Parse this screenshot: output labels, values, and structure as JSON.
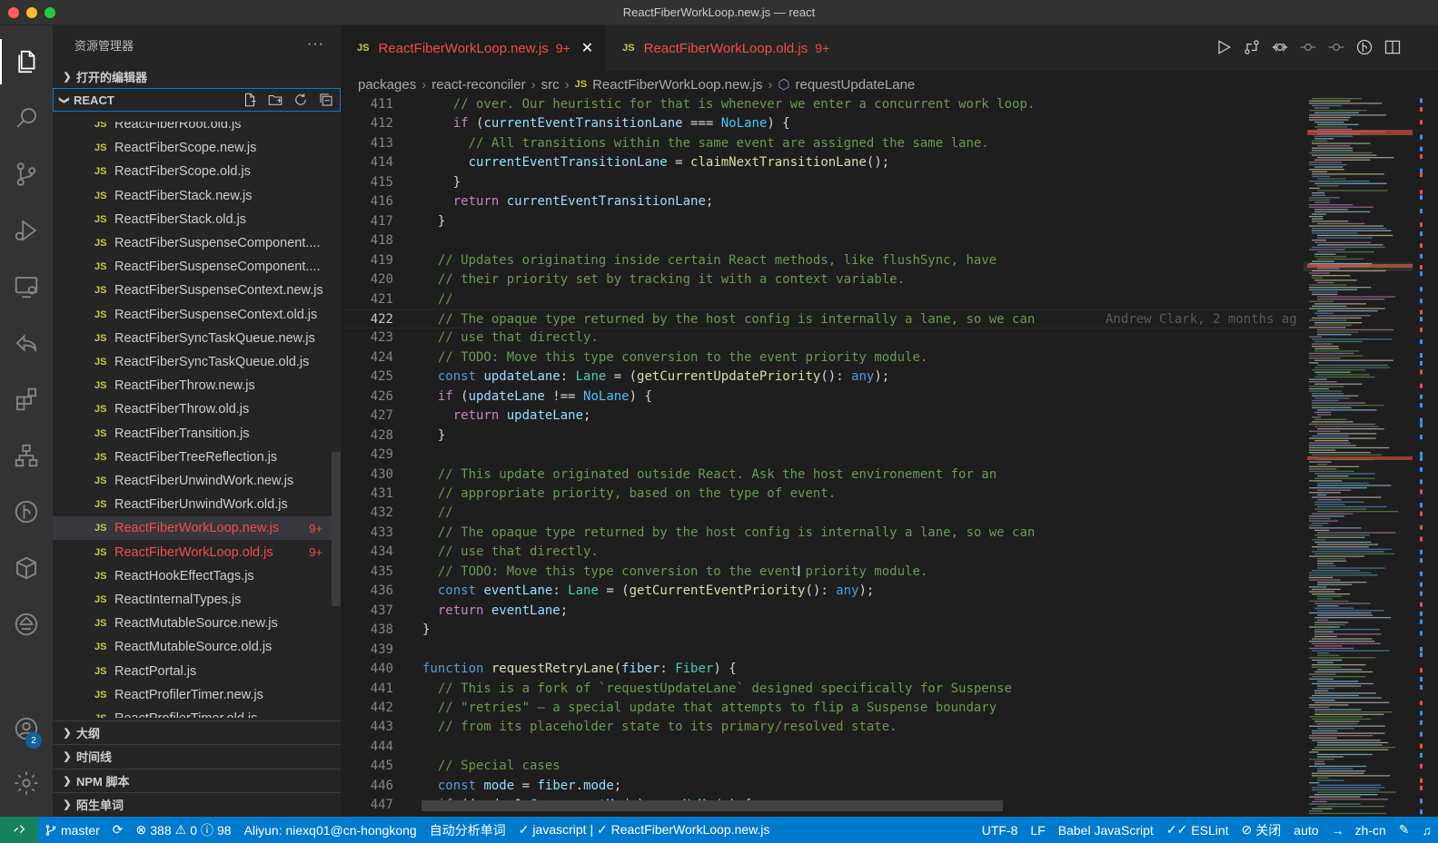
{
  "window": {
    "title": "ReactFiberWorkLoop.new.js — react"
  },
  "activity": {
    "accounts_badge": "2"
  },
  "sidebar": {
    "title": "资源管理器",
    "more": "···",
    "open_editors": "打开的编辑器",
    "root": "REACT",
    "files": [
      {
        "name": "ReactFiberRoot.old.js",
        "count": ""
      },
      {
        "name": "ReactFiberScope.new.js",
        "count": ""
      },
      {
        "name": "ReactFiberScope.old.js",
        "count": ""
      },
      {
        "name": "ReactFiberStack.new.js",
        "count": ""
      },
      {
        "name": "ReactFiberStack.old.js",
        "count": ""
      },
      {
        "name": "ReactFiberSuspenseComponent....",
        "count": ""
      },
      {
        "name": "ReactFiberSuspenseComponent....",
        "count": ""
      },
      {
        "name": "ReactFiberSuspenseContext.new.js",
        "count": ""
      },
      {
        "name": "ReactFiberSuspenseContext.old.js",
        "count": ""
      },
      {
        "name": "ReactFiberSyncTaskQueue.new.js",
        "count": ""
      },
      {
        "name": "ReactFiberSyncTaskQueue.old.js",
        "count": ""
      },
      {
        "name": "ReactFiberThrow.new.js",
        "count": ""
      },
      {
        "name": "ReactFiberThrow.old.js",
        "count": ""
      },
      {
        "name": "ReactFiberTransition.js",
        "count": ""
      },
      {
        "name": "ReactFiberTreeReflection.js",
        "count": ""
      },
      {
        "name": "ReactFiberUnwindWork.new.js",
        "count": ""
      },
      {
        "name": "ReactFiberUnwindWork.old.js",
        "count": ""
      },
      {
        "name": "ReactFiberWorkLoop.new.js",
        "count": "9+"
      },
      {
        "name": "ReactFiberWorkLoop.old.js",
        "count": "9+"
      },
      {
        "name": "ReactHookEffectTags.js",
        "count": ""
      },
      {
        "name": "ReactInternalTypes.js",
        "count": ""
      },
      {
        "name": "ReactMutableSource.new.js",
        "count": ""
      },
      {
        "name": "ReactMutableSource.old.js",
        "count": ""
      },
      {
        "name": "ReactPortal.js",
        "count": ""
      },
      {
        "name": "ReactProfilerTimer.new.js",
        "count": ""
      },
      {
        "name": "ReactProfilerTimer.old.js",
        "count": ""
      }
    ],
    "bottom_sections": [
      "大纲",
      "时间线",
      "NPM 脚本",
      "陌生单词"
    ]
  },
  "tabs": [
    {
      "label": "ReactFiberWorkLoop.new.js",
      "badge": "9+",
      "icon": "JS"
    },
    {
      "label": "ReactFiberWorkLoop.old.js",
      "badge": "9+",
      "icon": "JS"
    }
  ],
  "breadcrumb": {
    "items": [
      "packages",
      "react-reconciler",
      "src",
      "ReactFiberWorkLoop.new.js",
      "requestUpdateLane"
    ],
    "file_icon": "JS"
  },
  "editor": {
    "blame": "Andrew Clark, 2 months ag",
    "lines": [
      {
        "n": "411",
        "text": "    // over. Our heuristic for that is whenever we enter a concurrent work loop."
      },
      {
        "n": "412",
        "text": "    if (currentEventTransitionLane === NoLane) {"
      },
      {
        "n": "413",
        "text": "      // All transitions within the same event are assigned the same lane."
      },
      {
        "n": "414",
        "text": "      currentEventTransitionLane = claimNextTransitionLane();"
      },
      {
        "n": "415",
        "text": "    }"
      },
      {
        "n": "416",
        "text": "    return currentEventTransitionLane;"
      },
      {
        "n": "417",
        "text": "  }"
      },
      {
        "n": "418",
        "text": ""
      },
      {
        "n": "419",
        "text": "  // Updates originating inside certain React methods, like flushSync, have"
      },
      {
        "n": "420",
        "text": "  // their priority set by tracking it with a context variable."
      },
      {
        "n": "421",
        "text": "  //"
      },
      {
        "n": "422",
        "text": "  // The opaque type returned by the host config is internally a lane, so we can"
      },
      {
        "n": "423",
        "text": "  // use that directly."
      },
      {
        "n": "424",
        "text": "  // TODO: Move this type conversion to the event priority module."
      },
      {
        "n": "425",
        "text": "  const updateLane: Lane = (getCurrentUpdatePriority(): any);"
      },
      {
        "n": "426",
        "text": "  if (updateLane !== NoLane) {"
      },
      {
        "n": "427",
        "text": "    return updateLane;"
      },
      {
        "n": "428",
        "text": "  }"
      },
      {
        "n": "429",
        "text": ""
      },
      {
        "n": "430",
        "text": "  // This update originated outside React. Ask the host environement for an"
      },
      {
        "n": "431",
        "text": "  // appropriate priority, based on the type of event."
      },
      {
        "n": "432",
        "text": "  //"
      },
      {
        "n": "433",
        "text": "  // The opaque type returned by the host config is internally a lane, so we can"
      },
      {
        "n": "434",
        "text": "  // use that directly."
      },
      {
        "n": "435",
        "text": "  // TODO: Move this type conversion to the event priority module."
      },
      {
        "n": "436",
        "text": "  const eventLane: Lane = (getCurrentEventPriority(): any);"
      },
      {
        "n": "437",
        "text": "  return eventLane;"
      },
      {
        "n": "438",
        "text": "}"
      },
      {
        "n": "439",
        "text": ""
      },
      {
        "n": "440",
        "text": "function requestRetryLane(fiber: Fiber) {"
      },
      {
        "n": "441",
        "text": "  // This is a fork of `requestUpdateLane` designed specifically for Suspense"
      },
      {
        "n": "442",
        "text": "  // \"retries\" — a special update that attempts to flip a Suspense boundary"
      },
      {
        "n": "443",
        "text": "  // from its placeholder state to its primary/resolved state."
      },
      {
        "n": "444",
        "text": ""
      },
      {
        "n": "445",
        "text": "  // Special cases"
      },
      {
        "n": "446",
        "text": "  const mode = fiber.mode;"
      },
      {
        "n": "447",
        "text": "  if ((mode & ConcurrentMode) === NoMode) {"
      }
    ]
  },
  "statusbar": {
    "branch": "master",
    "errors": "388",
    "warnings": "0",
    "infos": "98",
    "account": "Aliyun: niexq01@cn-hongkong",
    "auto_analysis": "自动分析单词",
    "lint_info": "javascript | ✓ ReactFiberWorkLoop.new.js",
    "encoding": "UTF-8",
    "eol": "LF",
    "language": "Babel JavaScript",
    "eslint": "ESLint",
    "close": "关闭",
    "auto": "auto",
    "locale": "zh-cn"
  },
  "colors": {
    "accent": "#007acc",
    "remote": "#16825d",
    "modified": "#f14c4c",
    "comment": "#6a9955",
    "keyword": "#c586c0"
  }
}
